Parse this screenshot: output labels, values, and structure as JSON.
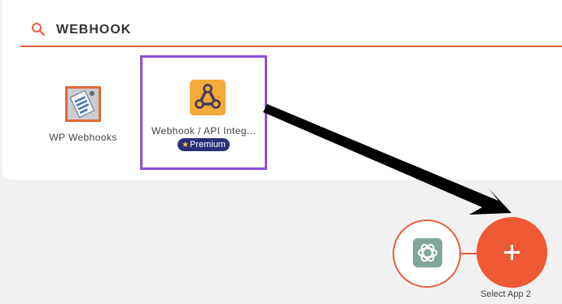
{
  "search": {
    "value": "WEBHOOK",
    "icon": "search-icon",
    "underline_color": "#e8603c"
  },
  "apps": [
    {
      "label": "WP Webhooks",
      "icon": "wp-webhooks-icon"
    },
    {
      "label": "Webhook / API Integ...",
      "icon": "webhook-icon",
      "badge": "Premium",
      "badge_icon": "star-icon",
      "highlight_color": "#8b50d8"
    }
  ],
  "flow": {
    "app1_icon": "openai-icon",
    "add_button_icon": "plus-icon",
    "select_label": "Select App 2",
    "accent": "#ef5a35"
  }
}
